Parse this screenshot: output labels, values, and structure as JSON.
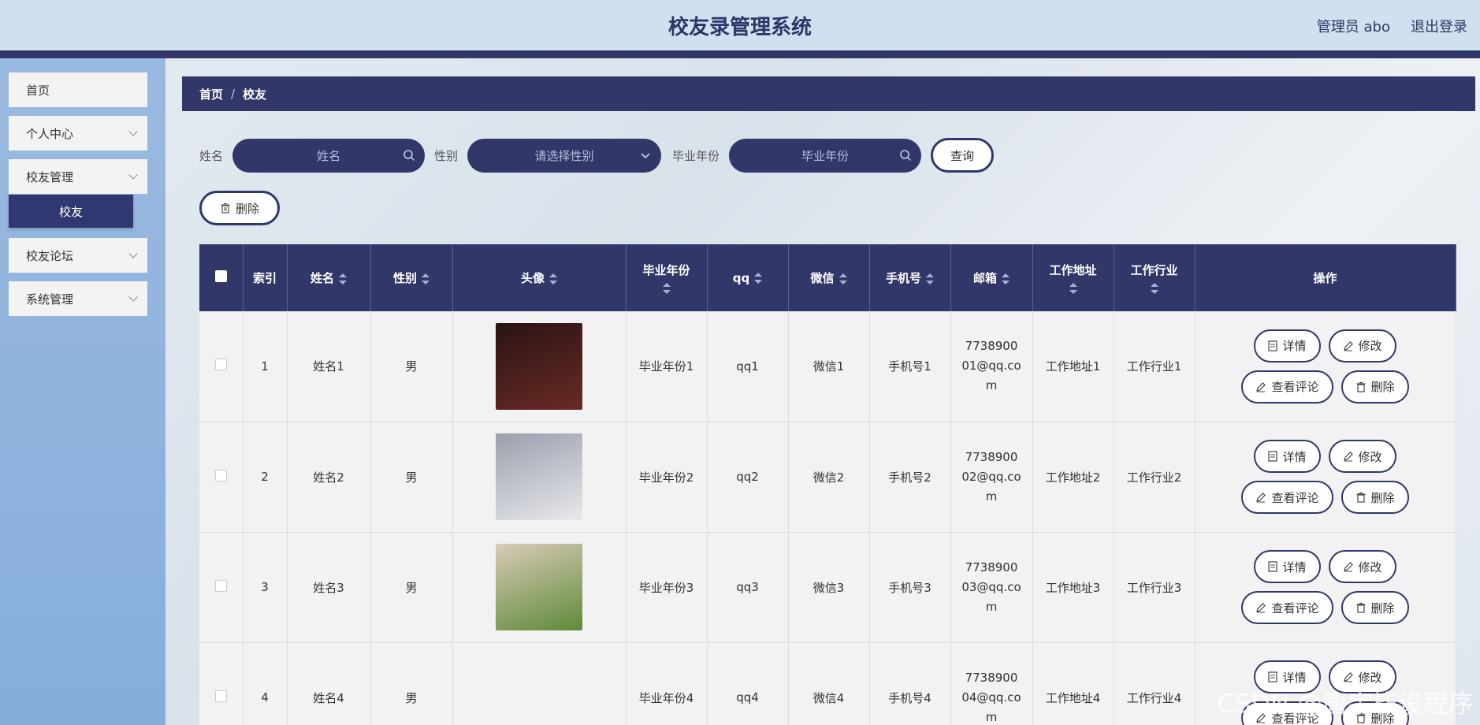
{
  "header": {
    "title": "校友录管理系统",
    "user": "管理员 abo",
    "logout": "退出登录"
  },
  "sidebar": {
    "items": [
      {
        "label": "首页"
      },
      {
        "label": "个人中心"
      },
      {
        "label": "校友管理"
      },
      {
        "label": "校友"
      },
      {
        "label": "校友论坛"
      },
      {
        "label": "系统管理"
      }
    ]
  },
  "breadcrumb": {
    "home": "首页",
    "separator": "/",
    "current": "校友"
  },
  "search": {
    "name_label": "姓名",
    "name_placeholder": "姓名",
    "gender_label": "性别",
    "gender_placeholder": "请选择性别",
    "year_label": "毕业年份",
    "year_placeholder": "毕业年份",
    "query_button": "查询",
    "delete_button": "删除"
  },
  "table": {
    "columns": [
      "索引",
      "姓名",
      "性别",
      "头像",
      "毕业年份",
      "qq",
      "微信",
      "手机号",
      "邮箱",
      "工作地址",
      "工作行业",
      "操作"
    ],
    "rows": [
      {
        "index": "1",
        "name": "姓名1",
        "gender": "男",
        "year": "毕业年份1",
        "qq": "qq1",
        "wechat": "微信1",
        "phone": "手机号1",
        "email": "773890001@qq.com",
        "address": "工作地址1",
        "industry": "工作行业1",
        "avatar_colors": [
          "#2a1414",
          "#6a2a24"
        ]
      },
      {
        "index": "2",
        "name": "姓名2",
        "gender": "男",
        "year": "毕业年份2",
        "qq": "qq2",
        "wechat": "微信2",
        "phone": "手机号2",
        "email": "773890002@qq.com",
        "address": "工作地址2",
        "industry": "工作行业2",
        "avatar_colors": [
          "#9aa0ad",
          "#e8e8ec"
        ]
      },
      {
        "index": "3",
        "name": "姓名3",
        "gender": "男",
        "year": "毕业年份3",
        "qq": "qq3",
        "wechat": "微信3",
        "phone": "手机号3",
        "email": "773890003@qq.com",
        "address": "工作地址3",
        "industry": "工作行业3",
        "avatar_colors": [
          "#d9cbb7",
          "#5f8a3a"
        ]
      },
      {
        "index": "4",
        "name": "姓名4",
        "gender": "男",
        "year": "毕业年份4",
        "qq": "qq4",
        "wechat": "微信4",
        "phone": "手机号4",
        "email": "773890004@qq.com",
        "address": "工作地址4",
        "industry": "工作行业4",
        "avatar_colors": null
      }
    ],
    "ops": {
      "detail": "详情",
      "edit": "修改",
      "comments": "查看评论",
      "delete": "删除"
    }
  },
  "watermark": "CSDN @唐宇毕设程序",
  "colors": {
    "primary": "#313869",
    "header_bg": "#cfe1ee",
    "sidebar_bg": "#8fb3dd"
  }
}
